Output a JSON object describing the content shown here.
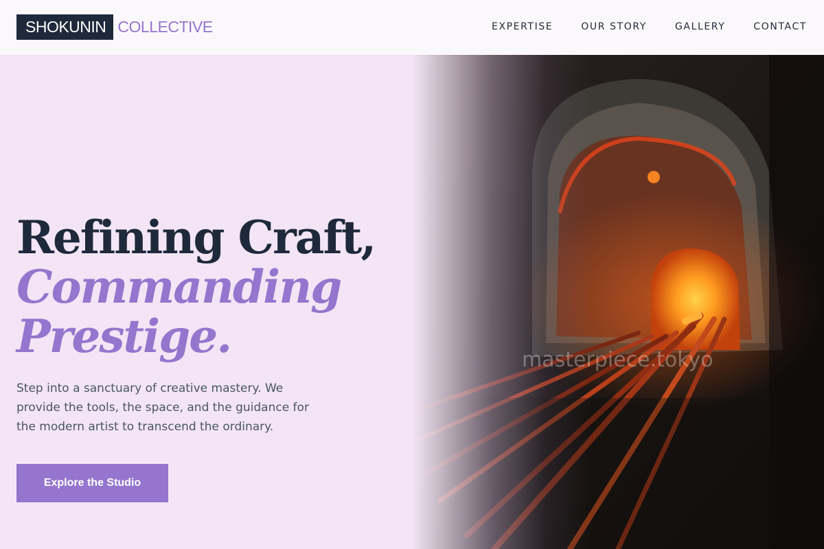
{
  "brand": {
    "box_text": "SHOKUNIN",
    "text": "COLLECTIVE"
  },
  "nav": {
    "items": [
      {
        "label": "EXPERTISE"
      },
      {
        "label": "OUR STORY"
      },
      {
        "label": "GALLERY"
      },
      {
        "label": "CONTACT"
      }
    ]
  },
  "hero": {
    "headline_line1": "Refining Craft,",
    "headline_line2": "Commanding",
    "headline_line3": "Prestige.",
    "subtitle": "Step into a sanctuary of creative mastery. We provide the tools, the space, and the guidance for the modern artist to transcend the ordinary.",
    "cta_label": "Explore the Studio",
    "image_watermark": "masterpiece.tokyo"
  },
  "colors": {
    "background": "#f3e5f5",
    "header_bg": "#fbf8fc",
    "navy": "#1e293b",
    "accent": "#9575cd",
    "body_text": "#4b5563"
  }
}
